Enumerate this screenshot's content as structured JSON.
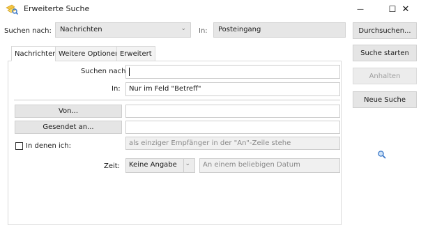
{
  "window": {
    "title": "Erweiterte Suche",
    "icons": [
      "app-search-icon"
    ],
    "controls": {
      "minimize": "—",
      "maximize": "☐",
      "close": "✕"
    }
  },
  "top": {
    "search_for_label": "Suchen nach:",
    "search_for_value": "Nachrichten",
    "in_label": "In:",
    "in_value": "Posteingang",
    "chevron": "⌄"
  },
  "tabs": [
    {
      "label": "Nachrichten",
      "active": true
    },
    {
      "label": "Weitere Optionen",
      "active": false
    },
    {
      "label": "Erweitert",
      "active": false
    }
  ],
  "form": {
    "search_label": "Suchen nach:",
    "search_value": "",
    "in_label": "In:",
    "in_value": "Nur im Feld \"Betreff\"",
    "from_button": "Von...",
    "from_value": "",
    "sent_to_button": "Gesendet an...",
    "sent_to_value": "",
    "where_i_label": "In denen ich:",
    "where_i_value": "als einziger Empfänger in der \"An\"-Zeile stehe",
    "time_label": "Zeit:",
    "time_value": "Keine Angabe",
    "date_value": "An einem beliebigen Datum",
    "chevron": "⌄"
  },
  "buttons": {
    "browse": "Durchsuchen...",
    "start": "Suche starten",
    "stop": "Anhalten",
    "new": "Neue Suche"
  },
  "colors": {
    "accent": "#0078d7",
    "icon_yellow": "#f4c542",
    "icon_blue": "#3b78c9"
  }
}
